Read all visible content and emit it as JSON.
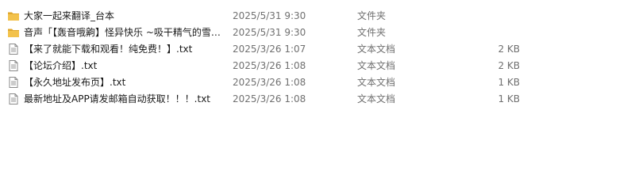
{
  "files": [
    {
      "icon": "folder-icon",
      "name": "大家一起来翻译_台本",
      "modified": "2025/5/31 9:30",
      "type": "文件夹",
      "size": ""
    },
    {
      "icon": "folder-icon",
      "name": "音声「【轰音哦齁】怪异快乐 ~吸干精气的雪…",
      "modified": "2025/5/31 9:30",
      "type": "文件夹",
      "size": ""
    },
    {
      "icon": "text-document-icon",
      "name": "【来了就能下载和观看！纯免费！】.txt",
      "modified": "2025/3/26 1:07",
      "type": "文本文档",
      "size": "2 KB"
    },
    {
      "icon": "text-document-icon",
      "name": "【论坛介绍】.txt",
      "modified": "2025/3/26 1:08",
      "type": "文本文档",
      "size": "2 KB"
    },
    {
      "icon": "text-document-icon",
      "name": "【永久地址发布页】.txt",
      "modified": "2025/3/26 1:08",
      "type": "文本文档",
      "size": "1 KB"
    },
    {
      "icon": "text-document-icon",
      "name": "最新地址及APP请发邮箱自动获取！！！.txt",
      "modified": "2025/3/26 1:08",
      "type": "文本文档",
      "size": "1 KB"
    }
  ],
  "colors": {
    "folder": "#f3c24b",
    "folder_tab": "#e0a82e",
    "doc_border": "#8a8a8a"
  }
}
